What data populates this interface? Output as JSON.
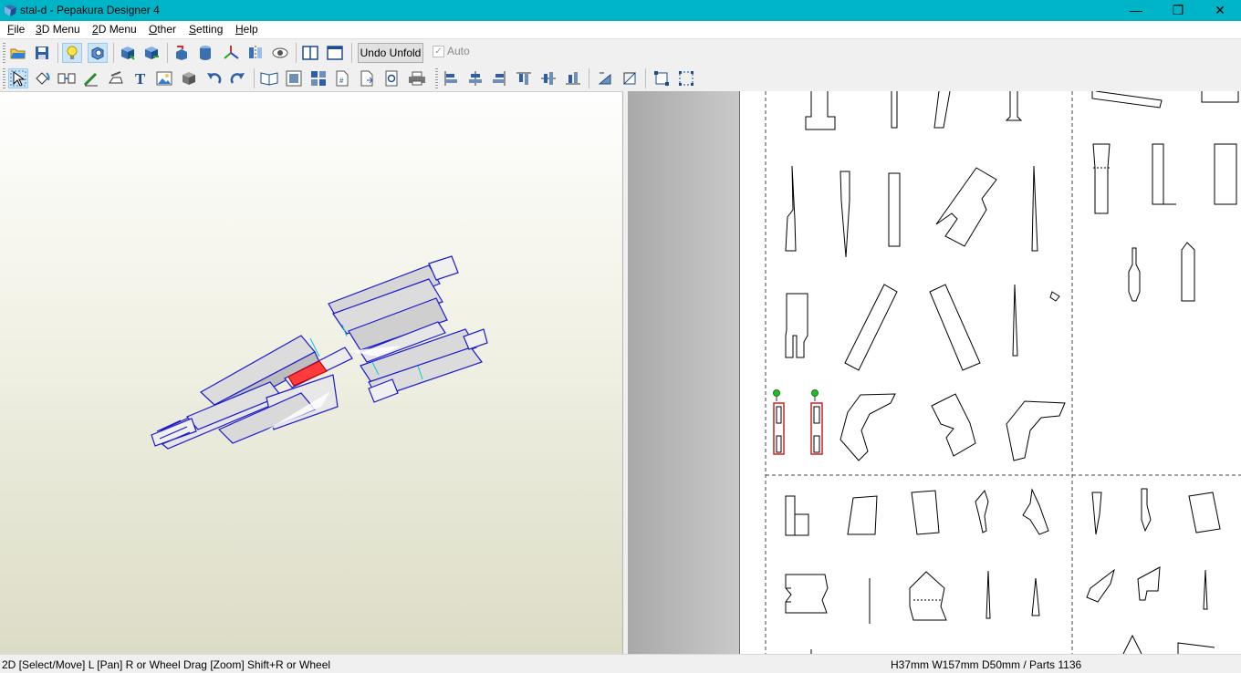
{
  "window": {
    "title": "stal-d - Pepakura Designer 4",
    "minimize": "—",
    "maximize": "❐",
    "close": "✕"
  },
  "menu": [
    "File",
    "3D Menu",
    "2D Menu",
    "Other",
    "Setting",
    "Help"
  ],
  "menu_mnemonics": [
    "F",
    "3",
    "2",
    "O",
    "S",
    "H"
  ],
  "toolbar1": {
    "undo_unfold_label": "Undo Unfold",
    "auto_label": "Auto",
    "auto_checked": true
  },
  "status": {
    "left": "2D [Select/Move] L [Pan] R or Wheel Drag [Zoom] Shift+R or Wheel",
    "right": "H37mm W157mm D50mm / Parts 1136"
  },
  "colors": {
    "titlebar": "#00b4c8",
    "model_edge": "#1a1acc",
    "selected_part": "#ff3b3b",
    "join_point": "#22bb22"
  }
}
